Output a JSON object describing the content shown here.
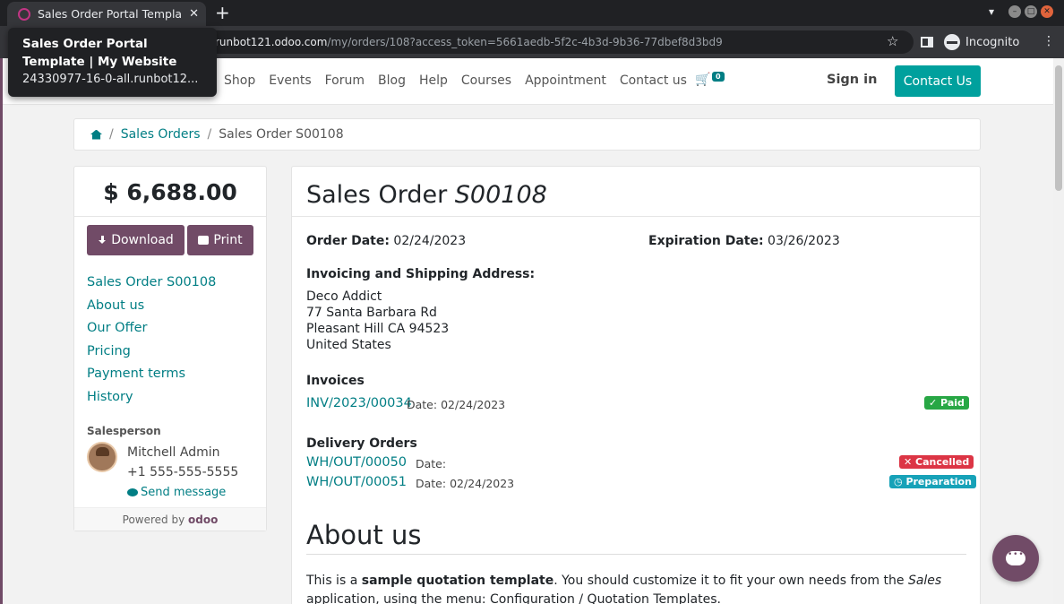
{
  "browser": {
    "tab_title": "Sales Order Portal Templa",
    "url_host": "runbot121.odoo.com",
    "url_path": "/my/orders/108?access_token=5661aedb-5f2c-4b3d-9b36-77dbef8d3bd9",
    "incognito_label": "Incognito",
    "tooltip_title": "Sales Order Portal Template | My Website",
    "tooltip_sub": "24330977-16-0-all.runbot12..."
  },
  "nav": {
    "menu": [
      "Shop",
      "Events",
      "Forum",
      "Blog",
      "Help",
      "Courses",
      "Appointment",
      "Contact us"
    ],
    "cart_count": "0",
    "sign_in": "Sign in",
    "contact_button": "Contact Us"
  },
  "breadcrumb": {
    "link": "Sales Orders",
    "current": "Sales Order S00108"
  },
  "sidebar": {
    "total": "$ 6,688.00",
    "download_label": "Download",
    "print_label": "Print",
    "toc": [
      "Sales Order S00108",
      "About us",
      "Our Offer",
      "Pricing",
      "Payment terms",
      "History"
    ],
    "salesperson_label": "Salesperson",
    "salesperson_name": "Mitchell Admin",
    "salesperson_phone": "+1 555-555-5555",
    "send_message": "Send message",
    "powered_by": "Powered by",
    "brand": "odoo"
  },
  "order": {
    "title_prefix": "Sales Order",
    "number": "S00108",
    "order_date_label": "Order Date:",
    "order_date": "02/24/2023",
    "expiration_label": "Expiration Date:",
    "expiration_date": "03/26/2023",
    "address_label": "Invoicing and Shipping Address:",
    "address_lines": [
      "Deco Addict",
      "77 Santa Barbara Rd",
      "Pleasant Hill CA 94523",
      "United States"
    ],
    "invoices_label": "Invoices",
    "invoice": {
      "ref": "INV/2023/00034",
      "date_label": "Date:",
      "date": "02/24/2023",
      "status": "Paid"
    },
    "deliveries_label": "Delivery Orders",
    "deliveries": [
      {
        "ref": "WH/OUT/00050",
        "date_label": "Date:",
        "date": "",
        "status": "Cancelled"
      },
      {
        "ref": "WH/OUT/00051",
        "date_label": "Date:",
        "date": "02/24/2023",
        "status": "Preparation"
      }
    ],
    "about_heading": "About us",
    "about_text_1": "This is a ",
    "about_bold": "sample quotation template",
    "about_text_2": ". You should customize it to fit your own needs from the ",
    "about_italic": "Sales",
    "about_text_3": " application, using the menu: Configuration / Quotation Templates."
  },
  "colors": {
    "primary": "#714b67",
    "link": "#017e84",
    "contact": "#00a09d",
    "paid": "#28a745",
    "cancelled": "#dc3545",
    "preparation": "#17a2b8"
  }
}
